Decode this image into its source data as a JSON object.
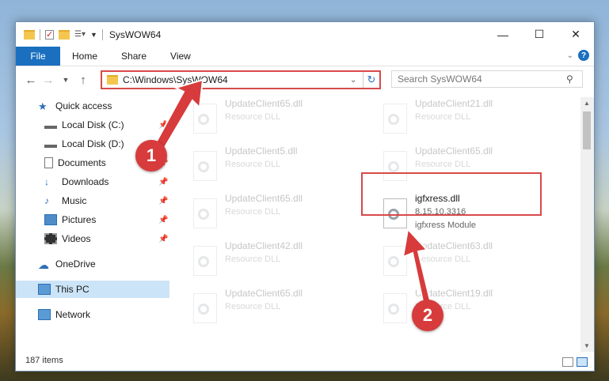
{
  "window": {
    "title": "SysWOW64"
  },
  "ribbon": {
    "tabs": [
      {
        "label": "File"
      },
      {
        "label": "Home"
      },
      {
        "label": "Share"
      },
      {
        "label": "View"
      }
    ]
  },
  "address": {
    "path": "C:\\Windows\\SysWOW64"
  },
  "search": {
    "placeholder": "Search SysWOW64"
  },
  "nav": {
    "items": [
      {
        "label": "Quick access",
        "icon": "star-icon"
      },
      {
        "label": "Local Disk (C:)",
        "icon": "drive-icon",
        "pinned": true
      },
      {
        "label": "Local Disk (D:)",
        "icon": "drive-icon",
        "pinned": true
      },
      {
        "label": "Documents",
        "icon": "documents-icon",
        "pinned": true
      },
      {
        "label": "Downloads",
        "icon": "download-icon",
        "pinned": true
      },
      {
        "label": "Music",
        "icon": "music-icon",
        "pinned": true
      },
      {
        "label": "Pictures",
        "icon": "pictures-icon",
        "pinned": true
      },
      {
        "label": "Videos",
        "icon": "videos-icon",
        "pinned": true
      },
      {
        "label": "OneDrive",
        "icon": "cloud-icon"
      },
      {
        "label": "This PC",
        "icon": "computer-icon",
        "selected": true
      },
      {
        "label": "Network",
        "icon": "network-icon"
      }
    ]
  },
  "files": [
    {
      "name": "UpdateClient65.dll",
      "sub": "Resource DLL",
      "dim": true
    },
    {
      "name": "UpdateClient21.dll",
      "sub": "Resource DLL",
      "dim": true
    },
    {
      "name": "UpdateClient5.dll",
      "sub": "Resource DLL",
      "dim": true
    },
    {
      "name": "UpdateClient65.dll",
      "sub": "Resource DLL",
      "dim": true
    },
    {
      "name": "UpdateClient65.dll",
      "sub": "Resource DLL",
      "dim": true
    },
    {
      "name": "igfxress.dll",
      "sub": "8.15.10.3316",
      "sub2": "igfxress Module",
      "dim": false
    },
    {
      "name": "UpdateClient42.dll",
      "sub": "Resource DLL",
      "dim": true
    },
    {
      "name": "UpdateClient63.dll",
      "sub": "Resource DLL",
      "dim": true
    },
    {
      "name": "UpdateClient65.dll",
      "sub": "Resource DLL",
      "dim": true
    },
    {
      "name": "UpdateClient19.dll",
      "sub": "Resource DLL",
      "dim": true
    }
  ],
  "status": {
    "count": "187 items"
  },
  "annotations": {
    "badge1": "1",
    "badge2": "2",
    "color": "#d73b3b"
  }
}
